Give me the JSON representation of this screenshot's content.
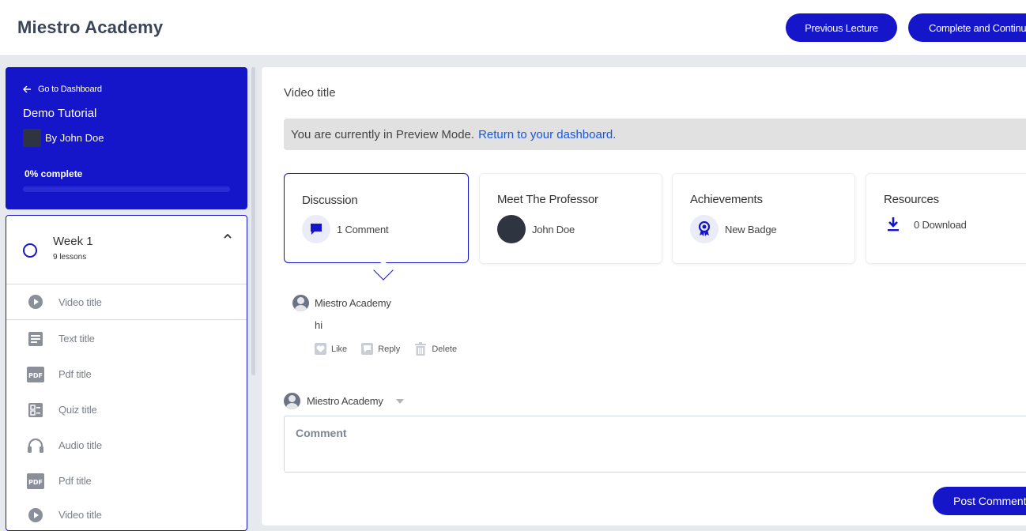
{
  "header": {
    "brand": "Miestro Academy",
    "prev_label": "Previous Lecture",
    "next_label": "Complete and Continue"
  },
  "course": {
    "back_label": "Go to Dashboard",
    "title": "Demo Tutorial",
    "author": "By John Doe",
    "progress_label": "0% complete",
    "progress_fraction": 0
  },
  "week": {
    "title": "Week 1",
    "lessons_count": "9 lessons"
  },
  "lessons": [
    {
      "label": "Video title",
      "icon": "play-circle-icon"
    },
    {
      "label": "Text title",
      "icon": "text-doc-icon"
    },
    {
      "label": "Pdf title",
      "icon": "pdf-icon"
    },
    {
      "label": "Quiz title",
      "icon": "quiz-icon"
    },
    {
      "label": "Audio title",
      "icon": "headphones-icon"
    },
    {
      "label": "Pdf title",
      "icon": "pdf-icon"
    },
    {
      "label": "Video title",
      "icon": "play-circle-icon"
    }
  ],
  "main": {
    "video_title": "Video title",
    "preview_text": "You are currently in Preview Mode.",
    "preview_link": "Return to your dashboard."
  },
  "tabs": {
    "discussion": {
      "title": "Discussion",
      "meta": "1 Comment"
    },
    "professor": {
      "title": "Meet The Professor",
      "meta": "John Doe"
    },
    "achievements": {
      "title": "Achievements",
      "meta": "New Badge"
    },
    "resources": {
      "title": "Resources",
      "meta": "0 Download"
    }
  },
  "comment": {
    "author": "Miestro Academy",
    "body": "hi",
    "like_label": "Like",
    "reply_label": "Reply",
    "delete_label": "Delete"
  },
  "composer": {
    "author": "Miestro Academy",
    "placeholder": "Comment",
    "post_label": "Post Comment"
  },
  "colors": {
    "accent": "#1515c9",
    "link": "#1a56db"
  }
}
